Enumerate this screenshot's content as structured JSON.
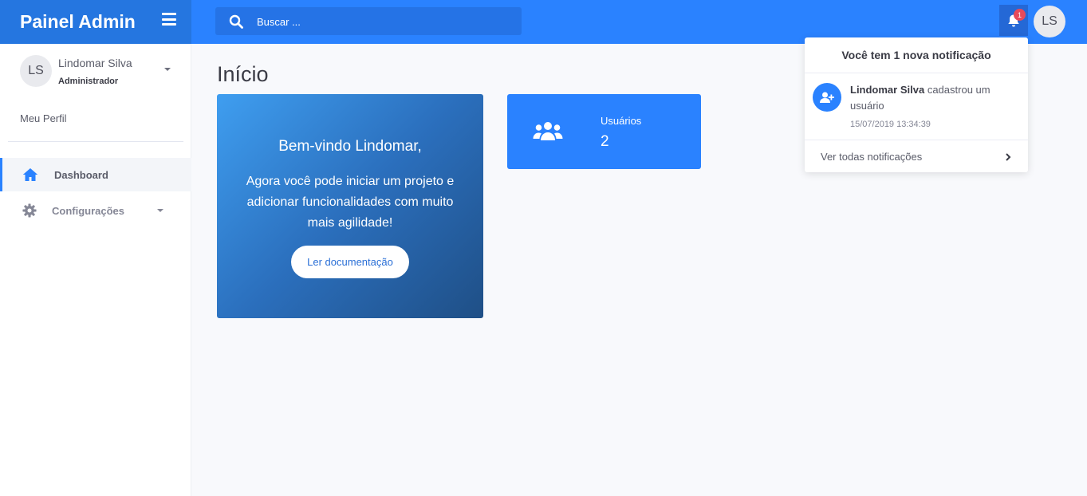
{
  "brand": {
    "title": "Painel Admin"
  },
  "search": {
    "placeholder": "Buscar ..."
  },
  "topbar": {
    "notification_count": "1",
    "avatar_initials": "LS"
  },
  "sidebar": {
    "user": {
      "initials": "LS",
      "name": "Lindomar Silva",
      "role": "Administrador"
    },
    "profile_link": "Meu Perfil",
    "items": [
      {
        "label": "Dashboard",
        "icon": "home-icon",
        "active": true
      },
      {
        "label": "Configurações",
        "icon": "gear-icon",
        "active": false
      }
    ]
  },
  "main": {
    "title": "Início",
    "welcome": {
      "title": "Bem-vindo Lindomar,",
      "text": "Agora você pode iniciar um projeto e adicionar funcionalidades com muito mais agilidade!",
      "button": "Ler documentação"
    },
    "stat": {
      "label": "Usuários",
      "value": "2",
      "icon": "users-icon"
    }
  },
  "notifications": {
    "header": "Você tem 1 nova notificação",
    "items": [
      {
        "user": "Lindomar Silva",
        "text": "cadastrou um usuário",
        "time": "15/07/2019 13:34:39",
        "icon": "user-plus-icon"
      }
    ],
    "footer": "Ver todas notificações"
  },
  "colors": {
    "primary": "#2a82ff",
    "brand": "#2576e0",
    "badge": "#e74a5b"
  }
}
